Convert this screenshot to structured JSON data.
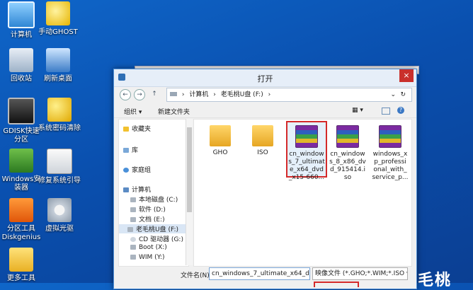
{
  "desktop": {
    "icons": [
      {
        "label": "计算机"
      },
      {
        "label": "手动GHOST"
      },
      {
        "label": "回收站"
      },
      {
        "label": "刷新桌面"
      },
      {
        "label": "GDISK快速分区"
      },
      {
        "label": "系统密码清除"
      },
      {
        "label": "Windows安装器"
      },
      {
        "label": "修复系统引导"
      },
      {
        "label": "分区工具Diskgenius"
      },
      {
        "label": "虚拟光驱"
      },
      {
        "label": "更多工具"
      }
    ],
    "brand_fragment": "毛桃"
  },
  "dialog": {
    "title": "打开",
    "close_glyph": "×",
    "nav": {
      "back": "←",
      "forward": "→",
      "up": "↑"
    },
    "address": {
      "root_sep": "›",
      "part1": "计算机",
      "sep": "›",
      "part2": "老毛桃U盘 (F:)",
      "sep2": "›",
      "dropdown": "⌄",
      "refresh": "↻"
    },
    "toolbar": {
      "organize": "组织 ▾",
      "new_folder": "新建文件夹",
      "view": "▦ ▾",
      "help": "?"
    },
    "sidebar": {
      "favorites": "收藏夹",
      "libraries": "库",
      "homegroup": "家庭组",
      "computer": "计算机",
      "drives": [
        "本地磁盘 (C:)",
        "软件 (D:)",
        "文档 (E:)",
        "老毛桃U盘 (F:)",
        "CD 驱动器 (G:)",
        "Boot (X:)",
        "WIM (Y:)"
      ]
    },
    "files": [
      {
        "name": "GHO",
        "kind": "folder"
      },
      {
        "name": "ISO",
        "kind": "folder"
      },
      {
        "name": "cn_window s_7_ultimat e_x64_dvd _x15-660...",
        "kind": "rar",
        "selected": true
      },
      {
        "name": "cn_window s_8_x86_dv d_915414.i so",
        "kind": "rar"
      },
      {
        "name": "windows_x p_professi onal_with_ service_p...",
        "kind": "rar"
      }
    ],
    "bottom": {
      "filename_label": "文件名(N):",
      "filename_value": "cn_windows_7_ultimate_x64_dv",
      "filetype_value": "映像文件 (*.GHO;*.WIM;*.ISO ▾"
    }
  }
}
